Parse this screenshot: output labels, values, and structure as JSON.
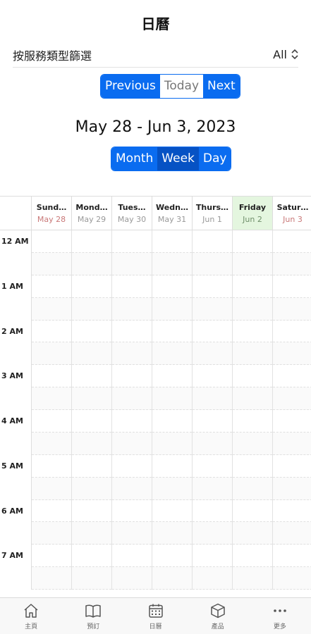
{
  "header": {
    "title": "日曆"
  },
  "filter": {
    "label": "按服務類型篩選",
    "value": "All"
  },
  "navigation": {
    "previous": "Previous",
    "today": "Today",
    "next": "Next"
  },
  "date_range": "May 28 - Jun 3, 2023",
  "views": {
    "month": "Month",
    "week": "Week",
    "day": "Day",
    "selected": "Week"
  },
  "week_days": [
    {
      "name": "Sund…",
      "date": "May 28"
    },
    {
      "name": "Mond…",
      "date": "May 29"
    },
    {
      "name": "Tues…",
      "date": "May 30"
    },
    {
      "name": "Wedn…",
      "date": "May 31"
    },
    {
      "name": "Thurs…",
      "date": "Jun 1"
    },
    {
      "name": "Friday",
      "date": "Jun 2"
    },
    {
      "name": "Satur…",
      "date": "Jun 3"
    }
  ],
  "hours": [
    "12 AM",
    "1 AM",
    "2 AM",
    "3 AM",
    "4 AM",
    "5 AM",
    "6 AM",
    "7 AM"
  ],
  "tabbar": [
    {
      "label": "主頁",
      "icon": "home-icon"
    },
    {
      "label": "預訂",
      "icon": "book-icon"
    },
    {
      "label": "日曆",
      "icon": "calendar-icon"
    },
    {
      "label": "產品",
      "icon": "box-icon"
    },
    {
      "label": "更多",
      "icon": "more-icon"
    }
  ],
  "colors": {
    "accent": "#0a6cf0",
    "today_bg": "#e4f6df",
    "weekend_date": "#c97878"
  }
}
